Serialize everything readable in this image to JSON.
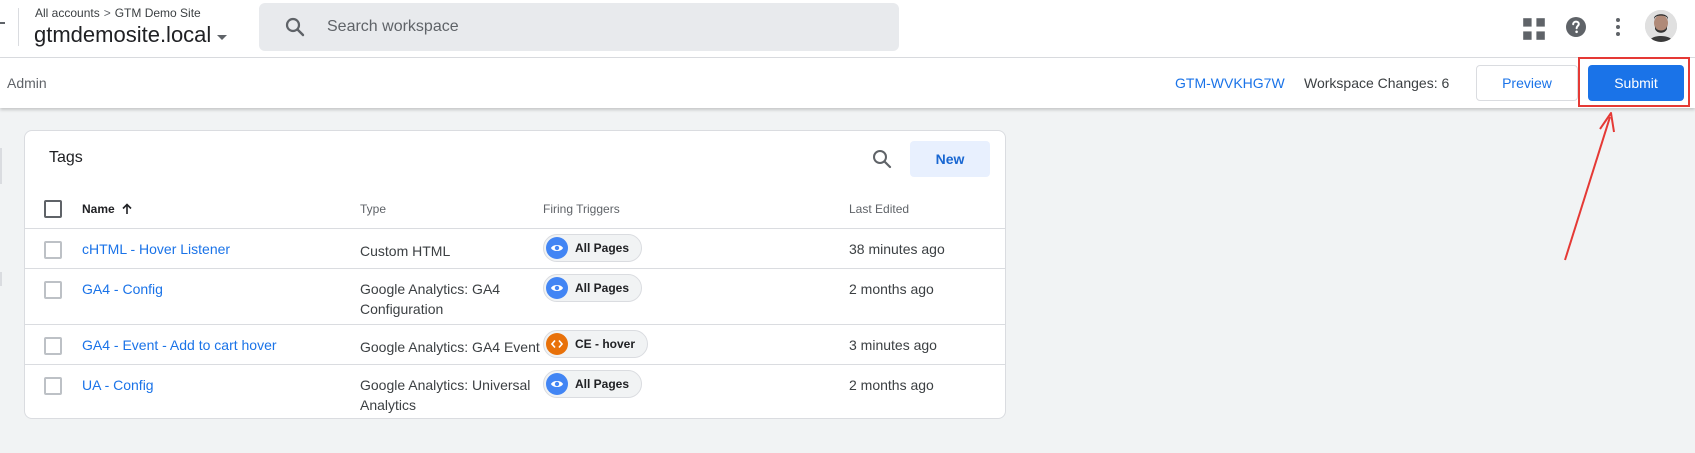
{
  "header": {
    "breadcrumb_root": "All accounts",
    "breadcrumb_separator": ">",
    "breadcrumb_account": "GTM Demo Site",
    "container_name": "gtmdemosite.local",
    "search_placeholder": "Search workspace"
  },
  "subbar": {
    "admin_label": "Admin",
    "container_id": "GTM-WVKHG7W",
    "workspace_changes": "Workspace Changes: 6",
    "preview_label": "Preview",
    "submit_label": "Submit"
  },
  "tags_card": {
    "title": "Tags",
    "new_label": "New",
    "columns": {
      "name": "Name",
      "type": "Type",
      "firing_triggers": "Firing Triggers",
      "last_edited": "Last Edited"
    },
    "rows": [
      {
        "name": "cHTML - Hover Listener",
        "type": "Custom HTML",
        "trigger": "All Pages",
        "trigger_icon": "eye-icon",
        "last_edited": "38 minutes ago"
      },
      {
        "name": "GA4 - Config",
        "type": "Google Analytics: GA4 Configuration",
        "trigger": "All Pages",
        "trigger_icon": "eye-icon",
        "last_edited": "2 months ago"
      },
      {
        "name": "GA4 - Event - Add to cart hover",
        "type": "Google Analytics: GA4 Event",
        "trigger": "CE - hover",
        "trigger_icon": "code-icon",
        "last_edited": "3 minutes ago"
      },
      {
        "name": "UA - Config",
        "type": "Google Analytics: Universal Analytics",
        "trigger": "All Pages",
        "trigger_icon": "eye-icon",
        "last_edited": "2 months ago"
      }
    ]
  },
  "colors": {
    "accent": "#1a73e8",
    "pageview_trigger": "#4285f4",
    "custom_event_trigger": "#e8710a",
    "annotation": "#e53935"
  }
}
